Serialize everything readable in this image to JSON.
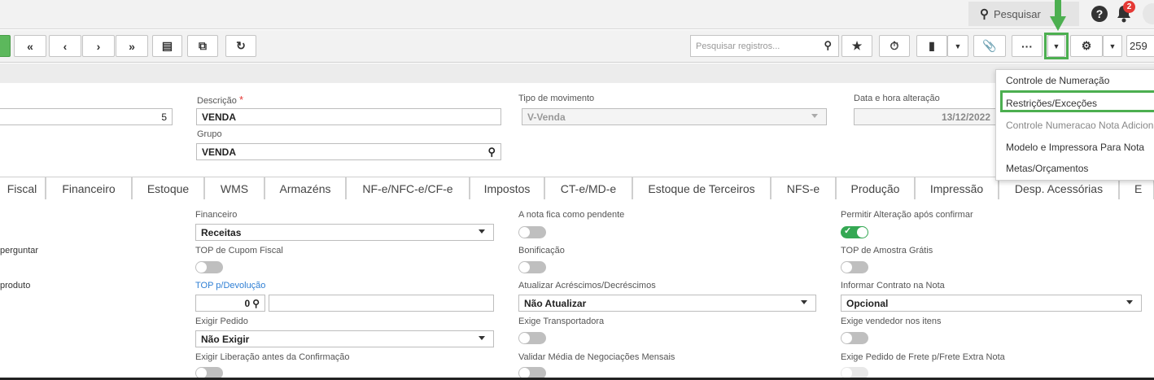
{
  "header": {
    "search_label": "Pesquisar",
    "notification_count": "2",
    "icons": [
      "search-icon",
      "help-icon",
      "bell-icon",
      "avatar"
    ]
  },
  "toolbar": {
    "record_search_placeholder": "Pesquisar registros...",
    "record_number": "259",
    "buttons": [
      "add-button",
      "first-record-button",
      "previous-record-button",
      "next-record-button",
      "last-record-button",
      "delete-button",
      "copy-button",
      "refresh-button",
      "favorite-button",
      "timer-button",
      "export-button",
      "export-menu-button",
      "attach-button",
      "more-button",
      "more-menu-button",
      "settings-button",
      "settings-menu-button"
    ]
  },
  "main": {
    "code_value": "5",
    "descricao_label": "Descrição",
    "descricao_value": "VENDA",
    "grupo_label": "Grupo",
    "grupo_value": "VENDA",
    "tipo_label": "Tipo de movimento",
    "tipo_value": "V-Venda",
    "data_label": "Data e hora alteração",
    "data_value": "13/12/2022"
  },
  "tabs": [
    "Fiscal",
    "Financeiro",
    "Estoque",
    "WMS",
    "Armazéns",
    "NF-e/NFC-e/CF-e",
    "Impostos",
    "CT-e/MD-e",
    "Estoque de Terceiros",
    "NFS-e",
    "Produção",
    "Impressão",
    "Desp. Acessórias",
    "E"
  ],
  "form": {
    "left_partial_1": "perguntar",
    "left_partial_2": "produto",
    "financeiro_label": "Financeiro",
    "financeiro_value": "Receitas",
    "top_cupom_label": "TOP de Cupom Fiscal",
    "top_devolucao_label": "TOP p/Devolução",
    "top_devolucao_value": "0",
    "exigir_pedido_label": "Exigir Pedido",
    "exigir_pedido_value": "Não Exigir",
    "exigir_liberacao_label": "Exigir Liberação antes da Confirmação",
    "nota_pendente_label": "A nota fica como pendente",
    "bonificacao_label": "Bonificação",
    "atualizar_label": "Atualizar Acréscimos/Decréscimos",
    "atualizar_value": "Não Atualizar",
    "exige_transp_label": "Exige Transportadora",
    "validar_media_label": "Validar Média de Negociações Mensais",
    "permitir_alt_label": "Permitir Alteração após confirmar",
    "top_amostra_label": "TOP de Amostra Grátis",
    "informar_contrato_label": "Informar Contrato na Nota",
    "informar_contrato_value": "Opcional",
    "exige_vendedor_label": "Exige vendedor nos itens",
    "exige_pedido_frete_label": "Exige Pedido de Frete p/Frete Extra Nota"
  },
  "dropdown": {
    "items": [
      "Controle de Numeração",
      "Restrições/Exceções",
      "Controle Numeracao Nota Adicional",
      "Modelo e Impressora Para Nota",
      "Metas/Orçamentos"
    ]
  },
  "colors": {
    "highlight": "#4caf50",
    "accent_blue": "#2f7fd4",
    "toggle_on": "#34a853",
    "badge": "#e53935"
  }
}
